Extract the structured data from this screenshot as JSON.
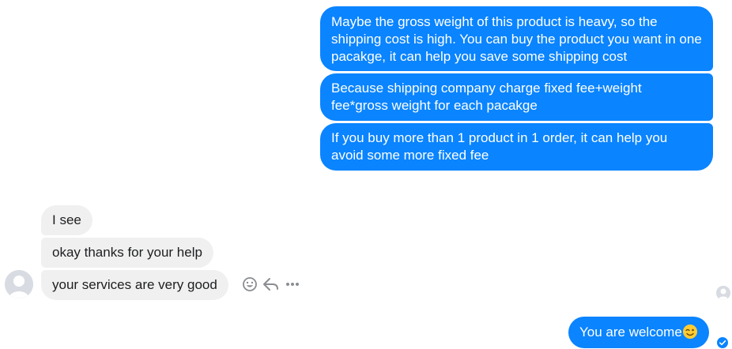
{
  "messages": {
    "outgoing": [
      "Maybe the gross weight of this product is heavy, so the shipping cost is high. You can buy the product you want in one pacakge, it can help you save some shipping cost",
      "Because shipping company charge fixed fee+weight fee*gross weight for each pacakge",
      "If you buy more than 1 product in 1 order, it can help you avoid some more fixed fee"
    ],
    "incoming": [
      "I see",
      "okay thanks for your help",
      "your services are very good"
    ],
    "reply": {
      "text": "You are welcome",
      "emoji": "wink-emoji"
    }
  },
  "actions": [
    {
      "icon": "smiley-react-icon"
    },
    {
      "icon": "reply-arrow-icon"
    },
    {
      "icon": "more-dots-icon"
    }
  ],
  "colors": {
    "outgoing_bubble": "#0a84ff",
    "incoming_bubble": "#f0f0f0",
    "incoming_text": "#1c1e21",
    "outgoing_text": "#ffffff"
  }
}
